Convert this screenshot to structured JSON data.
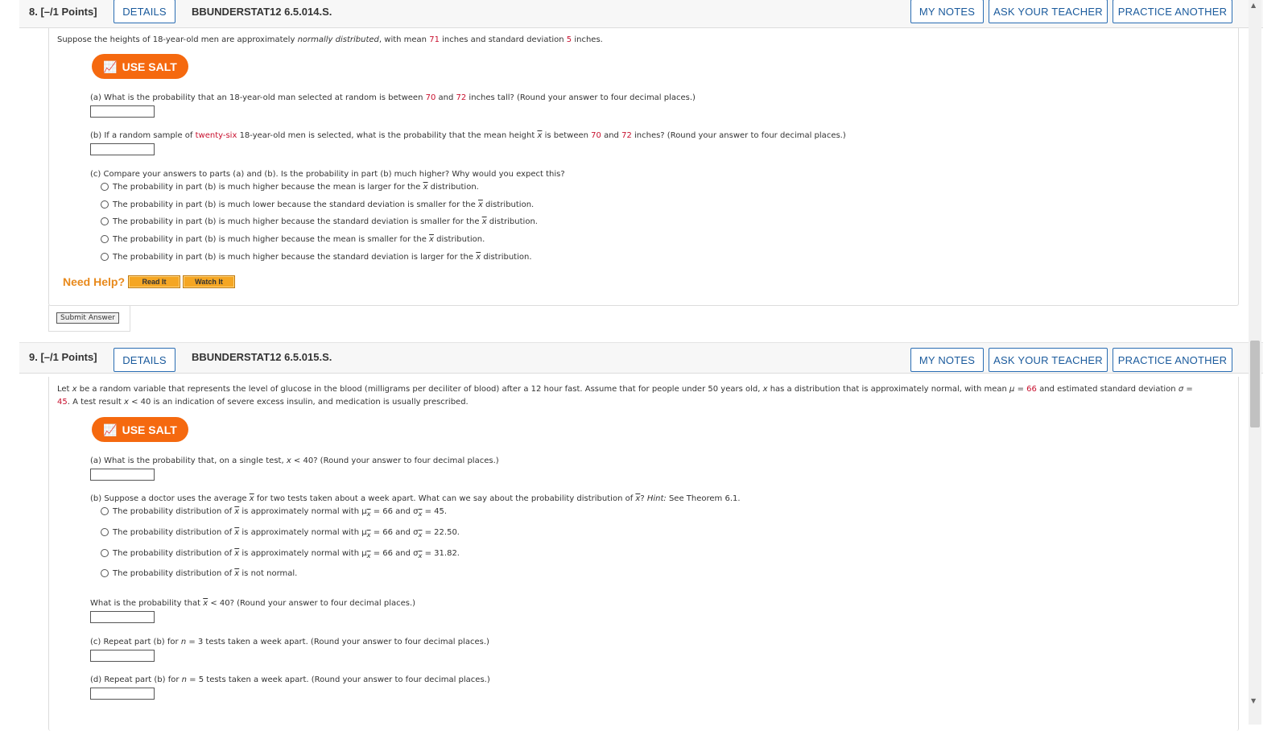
{
  "header_buttons": {
    "details": "DETAILS",
    "my_notes": "MY NOTES",
    "ask_teacher": "ASK YOUR TEACHER",
    "practice": "PRACTICE ANOTHER"
  },
  "q8": {
    "number": "8.",
    "points": "[–/1 Points]",
    "id": "BBUNDERSTAT12 6.5.014.S.",
    "intro": {
      "a": "Suppose the heights of 18-year-old men are approximately ",
      "b": "normally distributed",
      "c": ", with mean ",
      "mean": "71",
      "d": " inches and standard deviation ",
      "sd": "5",
      "e": " inches."
    },
    "salt": "USE SALT",
    "part_a": {
      "a": "(a) What is the probability that an 18-year-old man selected at random is between ",
      "v1": "70",
      "b": " and ",
      "v2": "72",
      "c": " inches tall? (Round your answer to four decimal places.)"
    },
    "part_b": {
      "a": "(b) If a random sample of ",
      "n": "twenty-six",
      "b": " 18-year-old men is selected, what is the probability that the mean height ",
      "xbar": "x",
      "c": " is between ",
      "v1": "70",
      "d": " and ",
      "v2": "72",
      "e": " inches? (Round your answer to four decimal places.)"
    },
    "part_c": "(c) Compare your answers to parts (a) and (b). Is the probability in part (b) much higher? Why would you expect this?",
    "options": [
      {
        "pre": "The probability in part (b) is much higher because the mean is larger for the ",
        "x": "x",
        "post": " distribution."
      },
      {
        "pre": "The probability in part (b) is much lower because the standard deviation is smaller for the ",
        "x": "x",
        "post": " distribution."
      },
      {
        "pre": "The probability in part (b) is much higher because the standard deviation is smaller for the ",
        "x": "x",
        "post": " distribution."
      },
      {
        "pre": "The probability in part (b) is much higher because the mean is smaller for the ",
        "x": "x",
        "post": " distribution."
      },
      {
        "pre": "The probability in part (b) is much higher because the standard deviation is larger for the ",
        "x": "x",
        "post": " distribution."
      }
    ],
    "need_help": "Need Help?",
    "read_it": "Read It",
    "watch_it": "Watch It",
    "submit": "Submit Answer"
  },
  "q9": {
    "number": "9.",
    "points": "[–/1 Points]",
    "id": "BBUNDERSTAT12 6.5.015.S.",
    "intro1": {
      "a": "Let ",
      "x": "x",
      "b": " be a random variable that represents the level of glucose in the blood (milligrams per deciliter of blood) after a 12 hour fast. Assume that for people under 50 years old, ",
      "x2": "x",
      "c": " has a distribution that is approximately normal, with mean ",
      "mu": "μ",
      "d": " = ",
      "mean": "66",
      "e": " and estimated standard deviation ",
      "sigma": "σ",
      "f": " ="
    },
    "intro2": {
      "sd": "45",
      "a": ". A test result ",
      "x": "x",
      "b": " < 40 is an indication of severe excess insulin, and medication is usually prescribed."
    },
    "salt": "USE SALT",
    "part_a": {
      "a": "(a) What is the probability that, on a single test, ",
      "x": "x",
      "b": " < 40? (Round your answer to four decimal places.)"
    },
    "part_b": {
      "a": "(b) Suppose a doctor uses the average ",
      "x1": "x",
      "b": " for two tests taken about a week apart. What can we say about the probability distribution of ",
      "x2": "x",
      "c": "? ",
      "hint": "Hint:",
      "d": " See Theorem 6.1."
    },
    "options": [
      {
        "pre": "The probability distribution of ",
        "x": "x",
        "mid": " is approximately normal with μ",
        "sub": "x",
        "mid2": " = 66 and σ",
        "sub2": "x",
        "post": " = 45."
      },
      {
        "pre": "The probability distribution of ",
        "x": "x",
        "mid": " is approximately normal with μ",
        "sub": "x",
        "mid2": " = 66 and σ",
        "sub2": "x",
        "post": " = 22.50."
      },
      {
        "pre": "The probability distribution of ",
        "x": "x",
        "mid": " is approximately normal with μ",
        "sub": "x",
        "mid2": " = 66 and σ",
        "sub2": "x",
        "post": " = 31.82."
      },
      {
        "pre": "The probability distribution of ",
        "x": "x",
        "post": " is not normal."
      }
    ],
    "what_prob": {
      "a": "What is the probability that ",
      "x": "x",
      "b": " < 40? (Round your answer to four decimal places.)"
    },
    "part_c": {
      "a": "(c) Repeat part (b) for ",
      "n": "n",
      "b": " = 3 tests taken a week apart. (Round your answer to four decimal places.)"
    },
    "part_d": {
      "a": "(d) Repeat part (b) for ",
      "n": "n",
      "b": " = 5 tests taken a week apart. (Round your answer to four decimal places.)"
    }
  }
}
